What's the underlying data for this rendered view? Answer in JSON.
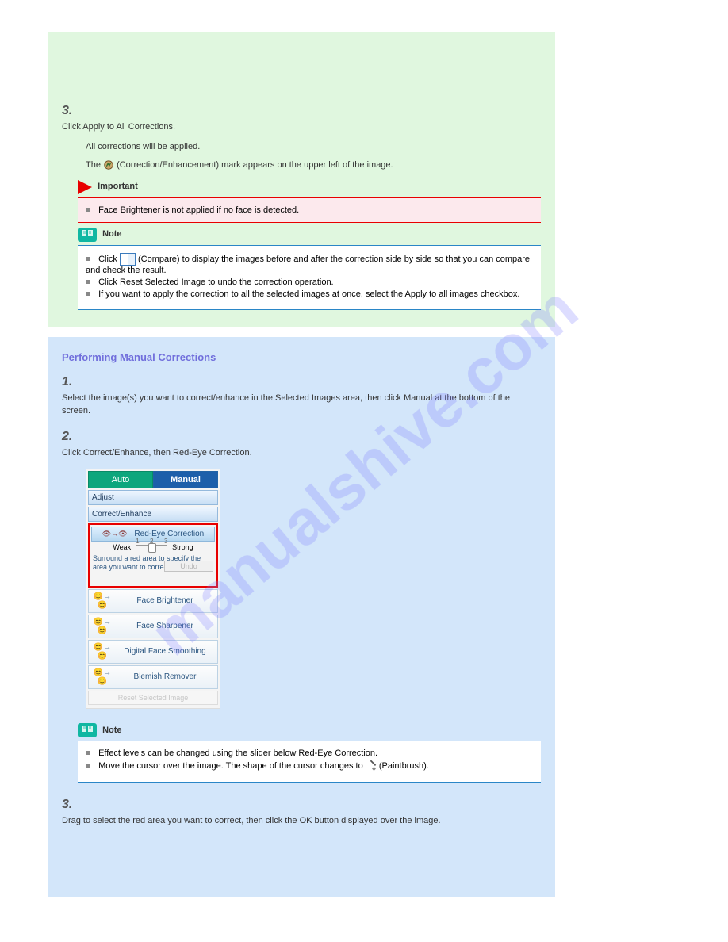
{
  "watermark": "manualshive.com",
  "step3": {
    "num": "3.",
    "text": "Click Apply to All Corrections.",
    "sub1": "All corrections will be applied.",
    "sub2_pre": "The ",
    "sub2_post": " (Correction/Enhancement) mark appears on the upper left of the image."
  },
  "importantLabel": "Important",
  "importantItem": "Face Brightener is not applied if no face is detected.",
  "noteLabel": "Note",
  "greenNote": {
    "item1_pre": "Click ",
    "item1_post": " (Compare) to display the images before and after the correction side by side so that you can compare and check the result.",
    "item2": "Click Reset Selected Image to undo the correction operation.",
    "item3": "If you want to apply the correction to all the selected images at once, select the Apply to all images checkbox."
  },
  "blueTitle": "Performing Manual Corrections",
  "step1": {
    "num": "1.",
    "text": "Select the image(s) you want to correct/enhance in the Selected Images area, then click Manual at the bottom of the screen."
  },
  "step2": {
    "num": "2.",
    "text": "Click Correct/Enhance, then Red-Eye Correction."
  },
  "ui": {
    "autoTab": "Auto",
    "manualTab": "Manual",
    "adjust": "Adjust",
    "correctEnhance": "Correct/Enhance",
    "redEye": "Red-Eye Correction",
    "weak": "Weak",
    "strong": "Strong",
    "hint": "Surround a red area to specify the area you want to correct",
    "undo": "Undo",
    "faceBrightener": "Face Brightener",
    "faceSharpener": "Face Sharpener",
    "digitalFaceSmoothing": "Digital Face Smoothing",
    "blemishRemover": "Blemish Remover",
    "reset": "Reset Selected Image"
  },
  "blueNote": {
    "item1": "Effect levels can be changed using the slider below Red-Eye Correction.",
    "item2_pre": "Move the cursor over the image. The shape of the cursor changes to ",
    "item2_post": " (Paintbrush)."
  },
  "step3b": {
    "num": "3.",
    "text": "Drag to select the red area you want to correct, then click the OK button displayed over the image."
  }
}
